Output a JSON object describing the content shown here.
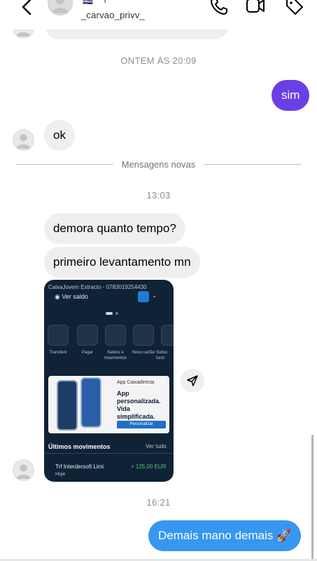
{
  "header": {
    "flag": "🇨🇻",
    "chevron": "›",
    "username": "_carvao_privv_"
  },
  "thread": {
    "ts_yesterday": "ONTEM ÀS 20:09",
    "msg_sim": "sim",
    "msg_ok": "ok",
    "new_messages": "Mensagens novas",
    "ts_1303": "13:03",
    "msg_demora": "demora quanto tempo?",
    "msg_primeiro": "primeiro levantamento mn",
    "ts_1621": "16:21",
    "msg_demais": "Demais mano demais 🚀"
  },
  "shared_screenshot": {
    "account_line": "CaixaJovem Extracto - 0783019254430",
    "see_balance": "Ver saldo",
    "tiles": [
      "Transferir",
      "Pagar",
      "Saldos e movimentos",
      "Novo cartão",
      "Subsc fund"
    ],
    "ad_kicker": "App Caixadirecta",
    "ad_title": "App personalizada. Vida simplificada.",
    "ad_button": "Personalizar",
    "movements_title": "Últimos movimentos",
    "see_all": "Ver tudo",
    "movement_desc": "Trf Interdersoft Limi",
    "movement_when": "Hoje",
    "movement_amount": "+ 125,00 EUR"
  },
  "colors": {
    "outgoing_purple": "#6a3fe6",
    "outgoing_blue": "#3797f0",
    "incoming_bubble": "#efefef"
  },
  "icons": [
    "back-arrow-icon",
    "phone-icon",
    "video-icon",
    "tag-icon",
    "send-icon"
  ]
}
